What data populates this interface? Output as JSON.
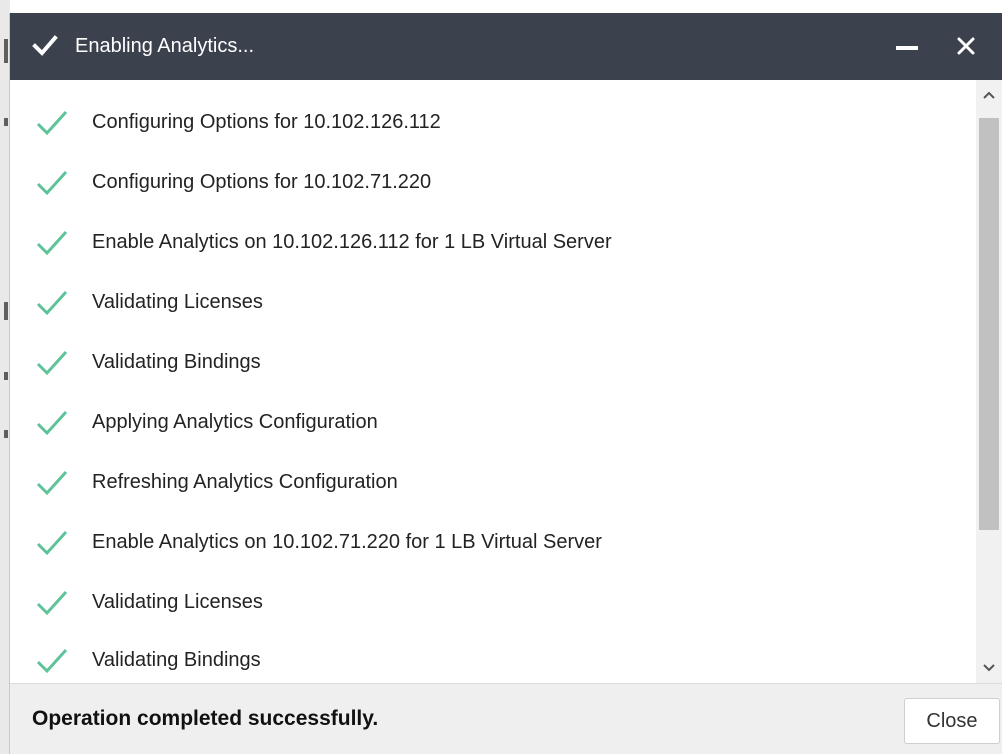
{
  "dialog": {
    "title": "Enabling Analytics...",
    "title_icon": "checkmark-icon",
    "controls": {
      "minimize_icon": "minimize-icon",
      "close_icon": "close-icon"
    }
  },
  "steps": [
    {
      "label": "Configuring Options for 10.102.126.112",
      "icon": "success-check-icon",
      "status": "done"
    },
    {
      "label": "Configuring Options for 10.102.71.220",
      "icon": "success-check-icon",
      "status": "done"
    },
    {
      "label": "Enable Analytics on 10.102.126.112 for 1 LB Virtual Server",
      "icon": "success-check-icon",
      "status": "done"
    },
    {
      "label": "Validating Licenses",
      "icon": "success-check-icon",
      "status": "done"
    },
    {
      "label": "Validating Bindings",
      "icon": "success-check-icon",
      "status": "done"
    },
    {
      "label": "Applying Analytics Configuration",
      "icon": "success-check-icon",
      "status": "done"
    },
    {
      "label": "Refreshing Analytics Configuration",
      "icon": "success-check-icon",
      "status": "done"
    },
    {
      "label": "Enable Analytics on 10.102.71.220 for 1 LB Virtual Server",
      "icon": "success-check-icon",
      "status": "done"
    },
    {
      "label": "Validating Licenses",
      "icon": "success-check-icon",
      "status": "done"
    },
    {
      "label": "Validating Bindings",
      "icon": "success-check-icon",
      "status": "done"
    }
  ],
  "footer": {
    "status": "Operation completed successfully.",
    "close_label": "Close"
  },
  "colors": {
    "titlebar": "#3b414d",
    "check_green": "#5fc39a",
    "footer_bg": "#efefef"
  }
}
